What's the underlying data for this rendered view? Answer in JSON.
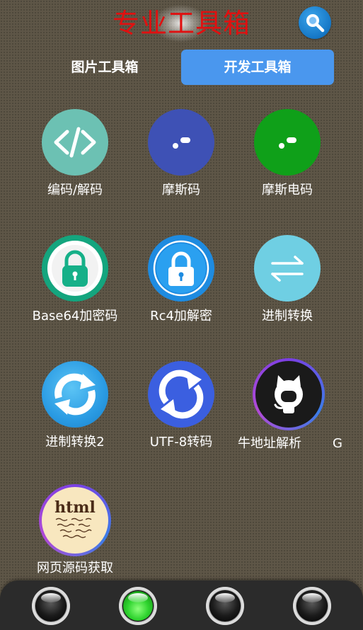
{
  "header": {
    "title": "专业工具箱",
    "title_color": "#e01010",
    "search_icon": "magnifier-icon"
  },
  "tabs": [
    {
      "label": "图片工具箱",
      "active": false
    },
    {
      "label": "开发工具箱",
      "active": true
    }
  ],
  "accent_color": "#4a97ee",
  "tools": [
    {
      "label": "编码/解码",
      "icon": "code-brackets-icon"
    },
    {
      "label": "摩斯码",
      "icon": "morse-dot-dash-icon"
    },
    {
      "label": "摩斯电码",
      "icon": "morse-dot-dash-icon"
    },
    {
      "label": "Base64加密码",
      "icon": "padlock-icon"
    },
    {
      "label": "Rc4加解密",
      "icon": "padlock-icon"
    },
    {
      "label": "进制转换",
      "icon": "swap-arrows-icon"
    },
    {
      "label": "进制转换2",
      "icon": "refresh-arrows-icon"
    },
    {
      "label": "UTF-8转码",
      "icon": "refresh-arrows-icon"
    },
    {
      "label": "牛地址解析",
      "icon": "github-octocat-icon"
    },
    {
      "label": "网页源码获取",
      "icon": "html-paper-icon"
    }
  ],
  "edge_label": "G",
  "dock": {
    "buttons": [
      {
        "state": "off"
      },
      {
        "state": "on"
      },
      {
        "state": "off"
      },
      {
        "state": "off"
      }
    ]
  }
}
